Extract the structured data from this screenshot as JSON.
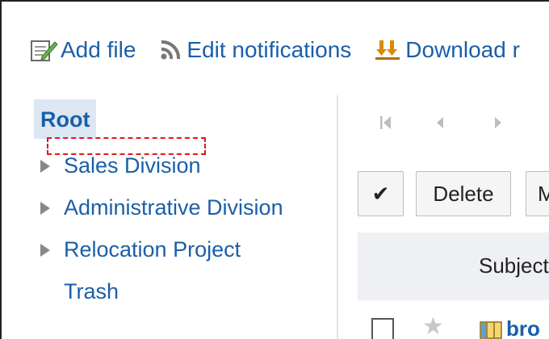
{
  "toolbar": {
    "add_file": "Add file",
    "edit_notifications": "Edit notifications",
    "download": "Download r"
  },
  "tree": {
    "root": "Root",
    "items": [
      {
        "label": "Sales Division",
        "expandable": true
      },
      {
        "label": "Administrative Division",
        "expandable": true
      },
      {
        "label": "Relocation Project",
        "expandable": true
      },
      {
        "label": "Trash",
        "expandable": false
      }
    ]
  },
  "actions": {
    "check_all": "✔",
    "delete": "Delete",
    "move": "M"
  },
  "table": {
    "subject_header": "Subject",
    "first_row_title": "bro"
  },
  "colors": {
    "link": "#1a5fa8",
    "root_highlight": "#dce7f3",
    "drop_marker": "#e1181f"
  }
}
